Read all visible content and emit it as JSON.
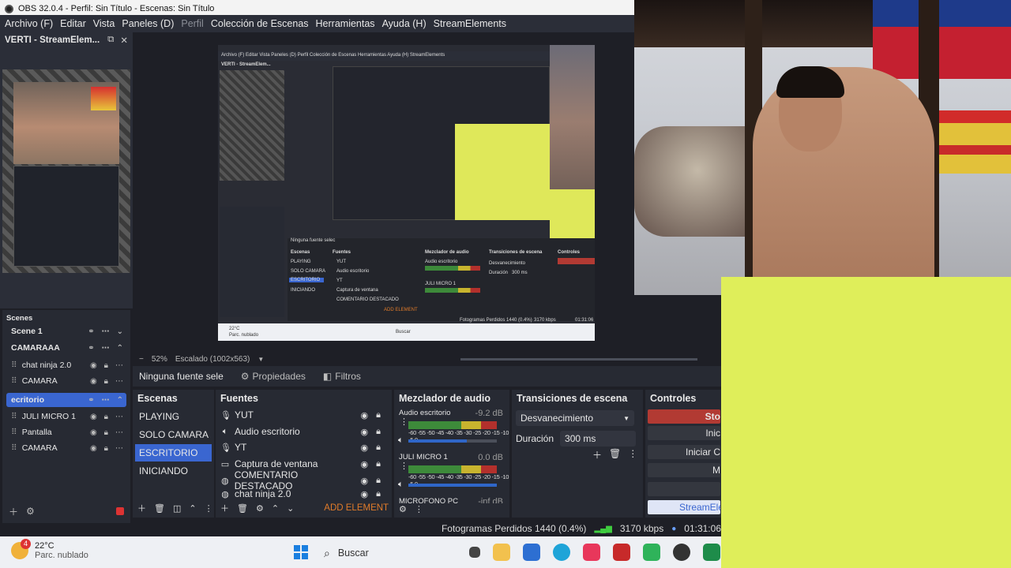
{
  "window": {
    "title": "OBS 32.0.4 - Perfil: Sin Título - Escenas: Sin Título"
  },
  "menu": {
    "items": [
      "Archivo (F)",
      "Editar",
      "Vista",
      "Paneles (D)",
      "Perfil",
      "Colección de Escenas",
      "Herramientas",
      "Ayuda (H)",
      "StreamElements"
    ]
  },
  "browser_dock": {
    "title": "VERTI - StreamElem...",
    "float_icon": "⧉",
    "close_icon": "✕"
  },
  "scenes_dock": {
    "title": "Scenes",
    "rows": [
      {
        "label": "Scene 1",
        "bold": true
      },
      {
        "label": "CAMARAAA",
        "bold": true
      },
      {
        "label": "chat ninja 2.0"
      },
      {
        "label": "CAMARA"
      },
      {
        "label": "ecritorio",
        "selected": true
      },
      {
        "label": "JULI MICRO 1"
      },
      {
        "label": "Pantalla"
      },
      {
        "label": "CAMARA"
      }
    ]
  },
  "preview": {
    "zoom": "52%",
    "scale_label": "Escalado (1002x563)",
    "nested_menu": "Archivo (F)  Editar  Vista  Paneles (D)  Perfil  Colección de Escenas  Herramientas  Ayuda (H)  StreamElements",
    "nested_source": "Ninguna fuente selec",
    "nested_search": "Buscar"
  },
  "source_bar": {
    "selected": "Ninguna fuente sele",
    "properties": "Propiedades",
    "filters": "Filtros"
  },
  "scenes": {
    "title": "Escenas",
    "items": [
      {
        "label": "PLAYING"
      },
      {
        "label": "SOLO CAMARA"
      },
      {
        "label": "ESCRITORIO",
        "selected": true
      },
      {
        "label": "INICIANDO"
      }
    ]
  },
  "sources": {
    "title": "Fuentes",
    "items": [
      {
        "label": "YUT",
        "icon": "mic-icon"
      },
      {
        "label": "Audio escritorio",
        "icon": "speaker-icon"
      },
      {
        "label": "YT",
        "icon": "mic-icon"
      },
      {
        "label": "Captura de ventana",
        "icon": "window-icon"
      },
      {
        "label": "COMENTARIO DESTACADO",
        "icon": "globe-icon"
      },
      {
        "label": "chat ninja 2.0",
        "icon": "globe-icon"
      }
    ],
    "add_element": "ADD ELEMENT"
  },
  "mixer": {
    "title": "Mezclador de audio",
    "scale": "-60 -55 -50 -45 -40 -35 -30 -25 -20 -15 -10 -5 0",
    "channels": [
      {
        "name": "Audio escritorio",
        "db": "-9.2 dB",
        "level": 0.66
      },
      {
        "name": "JULI MICRO 1",
        "db": "0.0 dB",
        "level": 1.0
      },
      {
        "name": "MICROFONO PC",
        "db": "-inf dB",
        "level": 0
      }
    ]
  },
  "transitions": {
    "title": "Transiciones de escena",
    "selected": "Desvanecimiento",
    "duration_label": "Duración",
    "duration_value": "300 ms"
  },
  "controls": {
    "title": "Controles",
    "buttons": [
      "Sto",
      "Inic",
      "Iniciar C",
      "M",
      "",
      "StreamEle"
    ]
  },
  "status": {
    "dropped_frames": "Fotogramas Perdidos 1440 (0.4%)",
    "bitrate": "3170 kbps",
    "time": "01:31:06"
  },
  "taskbar": {
    "temperature": "22°C",
    "condition": "Parc. nublado",
    "alert_count": "4",
    "search_label": "Buscar"
  },
  "colors": {
    "accent": "#3a66d0",
    "stream_red": "#b23a33",
    "overlay_yellow": "#dfee5a",
    "add_element": "#e07b2a"
  }
}
